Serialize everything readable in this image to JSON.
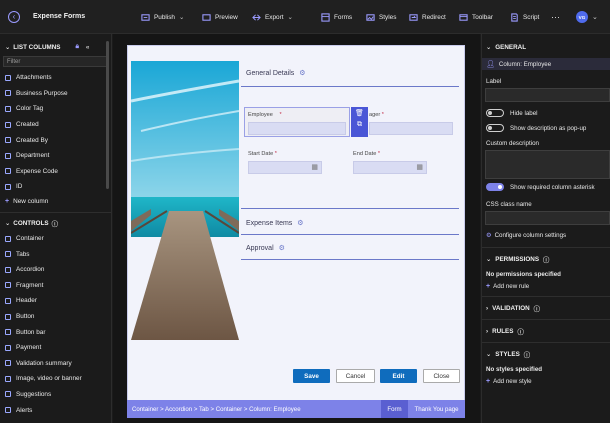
{
  "app": {
    "title": "Expense Forms",
    "avatar_initials": "VG"
  },
  "toolbar": {
    "publish": "Publish",
    "preview": "Preview",
    "export": "Export",
    "forms": "Forms",
    "styles": "Styles",
    "redirect": "Redirect",
    "toolbar": "Toolbar",
    "script": "Script",
    "more": "···"
  },
  "left": {
    "list_columns_title": "LIST COLUMNS",
    "filter_placeholder": "Filter",
    "columns": [
      "Attachments",
      "Business Purpose",
      "Color Tag",
      "Created",
      "Created By",
      "Department",
      "Expense Code",
      "ID"
    ],
    "new_column": "New column",
    "controls_title": "CONTROLS",
    "controls": [
      "Container",
      "Tabs",
      "Accordion",
      "Fragment",
      "Header",
      "Button",
      "Button bar",
      "Payment",
      "Validation summary",
      "Image, video or banner",
      "Suggestions",
      "Alerts"
    ]
  },
  "form": {
    "sections": {
      "general": "General Details",
      "expense_items": "Expense Items",
      "approval": "Approval"
    },
    "fields": {
      "employee": "Employee",
      "manager": "ager",
      "start_date": "Start Date",
      "end_date": "End Date",
      "required_mark": "*"
    },
    "buttons": {
      "save": "Save",
      "cancel": "Cancel",
      "edit": "Edit",
      "close": "Close"
    },
    "breadcrumb": "Container > Accordion > Tab > Container > Column: Employee",
    "tabs": {
      "form": "Form",
      "thank_you": "Thank You page"
    }
  },
  "right": {
    "general_title": "GENERAL",
    "column_name": "Column: Employee",
    "label_title": "Label",
    "hide_label": "Hide label",
    "show_desc_popup": "Show description as pop-up",
    "custom_description": "Custom description",
    "show_required_asterisk": "Show required column asterisk",
    "css_class_name": "CSS class name",
    "configure_settings": "Configure column settings",
    "permissions_title": "PERMISSIONS",
    "no_permissions": "No permissions specified",
    "add_rule": "Add new rule",
    "validation_title": "VALIDATION",
    "rules_title": "RULES",
    "styles_title": "STYLES",
    "no_styles": "No styles specified",
    "add_style": "Add new style"
  },
  "colors": {
    "accent": "#7d82e8",
    "primary_button": "#0f6cbd",
    "background": "#1b1b1b"
  }
}
